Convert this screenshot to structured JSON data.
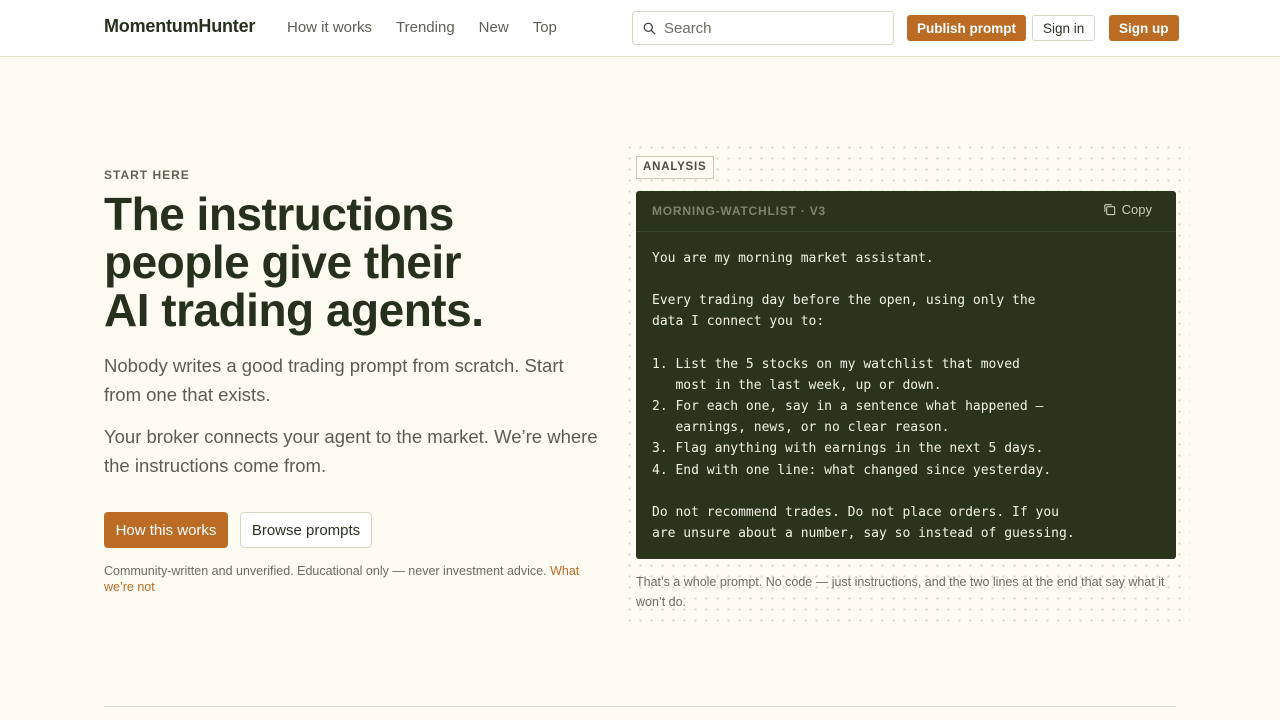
{
  "header": {
    "brand": "MomentumHunter",
    "nav": [
      "How it works",
      "Trending",
      "New",
      "Top"
    ],
    "search_placeholder": "Search",
    "publish_label": "Publish prompt",
    "signin_label": "Sign in",
    "signup_label": "Sign up"
  },
  "hero": {
    "eyebrow": "START HERE",
    "headline_lines": [
      "The instructions",
      "people give their",
      "AI trading agents."
    ],
    "lede_1": "Nobody writes a good trading prompt from scratch. Start from one that exists.",
    "lede_2": "Your broker connects your agent to the market. We’re where the instructions come from.",
    "cta_primary": "How this works",
    "cta_secondary": "Browse prompts",
    "disclaimer": "Community-written and unverified. Educational only — never investment advice.",
    "disclaimer_link": "What we’re not"
  },
  "example": {
    "tag": "ANALYSIS",
    "title": "MORNING-WATCHLIST · V3",
    "copy_label": "Copy",
    "prompt": "You are my morning market assistant.\n\nEvery trading day before the open, using only the\ndata I connect you to:\n\n1. List the 5 stocks on my watchlist that moved\n   most in the last week, up or down.\n2. For each one, say in a sentence what happened —\n   earnings, news, or no clear reason.\n3. Flag anything with earnings in the next 5 days.\n4. End with one line: what changed since yesterday.\n\nDo not recommend trades. Do not place orders. If you\nare unsure about a number, say so instead of guessing.",
    "caption": "That’s a whole prompt. No code — just instructions, and the two lines at the end that say what it won’t do."
  },
  "colors": {
    "accent": "#bc6b24",
    "background": "#fdfbf2",
    "card": "#2a341c",
    "ink": "#26301c"
  }
}
